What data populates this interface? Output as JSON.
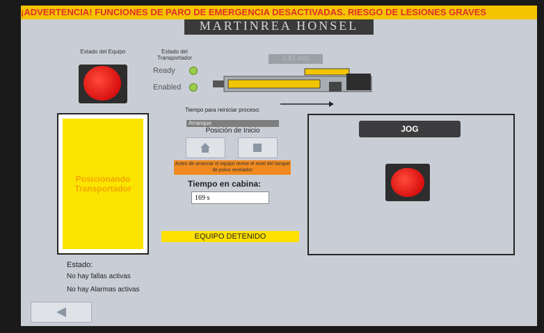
{
  "banner": {
    "text": "¡ADVERTENCIA! FUNCIONES DE PARO DE EMERGENCIA DESACTIVADAS. RIESGO DE LESIONES GRAVES"
  },
  "brand": {
    "text": "MARTINREA HONSEL"
  },
  "equipo": {
    "label": "Estado del Equipo"
  },
  "transportador": {
    "label": "Estado del Transportador",
    "ready_label": "Ready",
    "enabled_label": "Enabled"
  },
  "counter": {
    "value": "2.51 m/s"
  },
  "proceso": {
    "tiempo_reiniciar_label": "Tiempo para reiniciar proceso:"
  },
  "arranque": {
    "section_label": "Arranque",
    "posicion_label": "Posición de Inicio"
  },
  "warning": {
    "text": "Antes de arrancar el equipo revise el nivel del tanque de polvo revelador"
  },
  "cabina": {
    "label": "Tiempo en cabina:",
    "value": "169 s"
  },
  "status_panel": {
    "text": "Posicionando Transportador"
  },
  "equipo_estado": {
    "text": "EQUIPO DETENIDO"
  },
  "jog": {
    "label": "JOG"
  },
  "estado": {
    "label": "Estado:",
    "fallas": "No hay fallas activas",
    "alarmas": "No hay Alarmas activas"
  },
  "colors": {
    "banner_bg": "#f5c400",
    "banner_text": "#e0302a",
    "status_yellow": "#fbe500",
    "lamp_red": "#e01a10",
    "indicator_green": "#9ccd4b"
  },
  "icons": {
    "home": "home-icon",
    "stop": "stop-icon",
    "back": "back-arrow-icon"
  }
}
